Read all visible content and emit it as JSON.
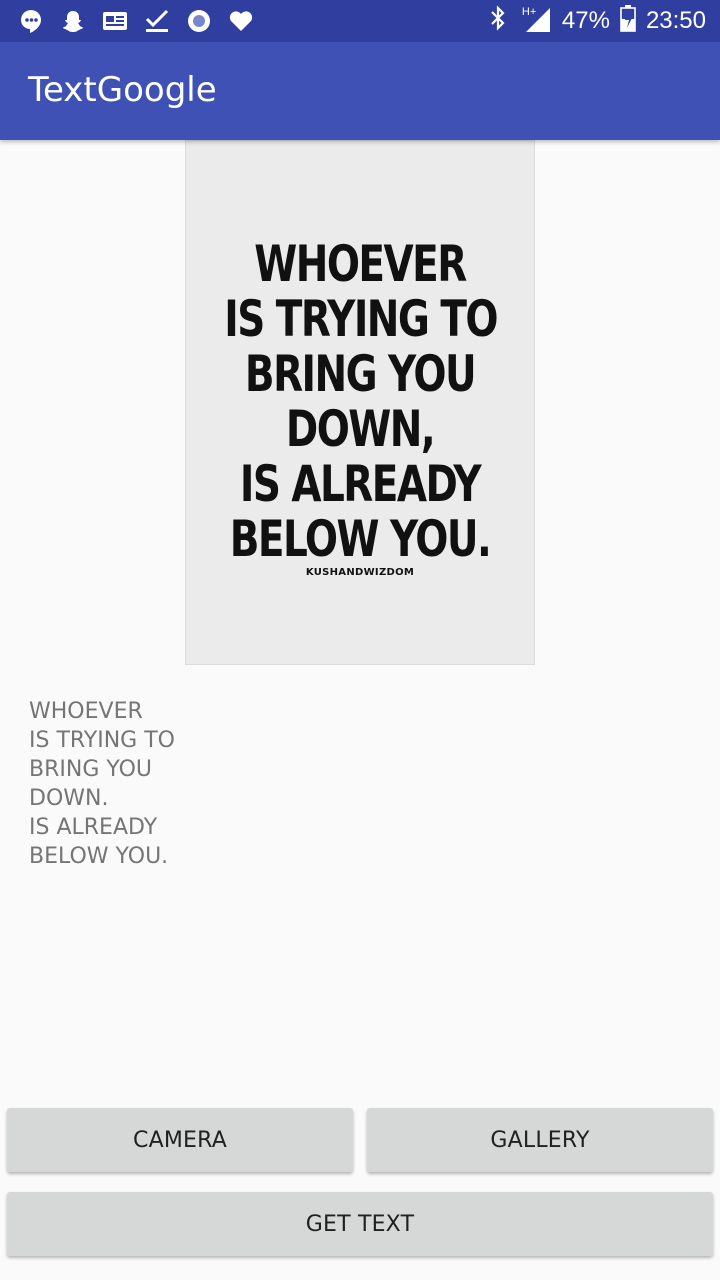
{
  "status_bar": {
    "icons": [
      "hangouts-icon",
      "snapchat-icon",
      "news-icon",
      "task-check-icon",
      "record-icon",
      "heart-icon"
    ],
    "network_label": "H+",
    "battery_percent": "47%",
    "time": "23:50"
  },
  "app_bar": {
    "title": "TextGoogle",
    "color": "#3f51b5",
    "status_color": "#303f9f"
  },
  "preview_image": {
    "lines": [
      "WHOEVER",
      "IS TRYING TO",
      "BRING YOU",
      "DOWN,",
      "IS ALREADY",
      "BELOW YOU."
    ],
    "credit": "KUSHANDWIZDOM"
  },
  "result_text": {
    "lines": [
      "WHOEVER",
      "IS TRYING TO",
      "BRING YOU",
      "DOWN.",
      "IS ALREADY",
      "BELOW YOU."
    ]
  },
  "buttons": {
    "camera": "CAMERA",
    "gallery": "GALLERY",
    "get_text": "GET TEXT"
  }
}
